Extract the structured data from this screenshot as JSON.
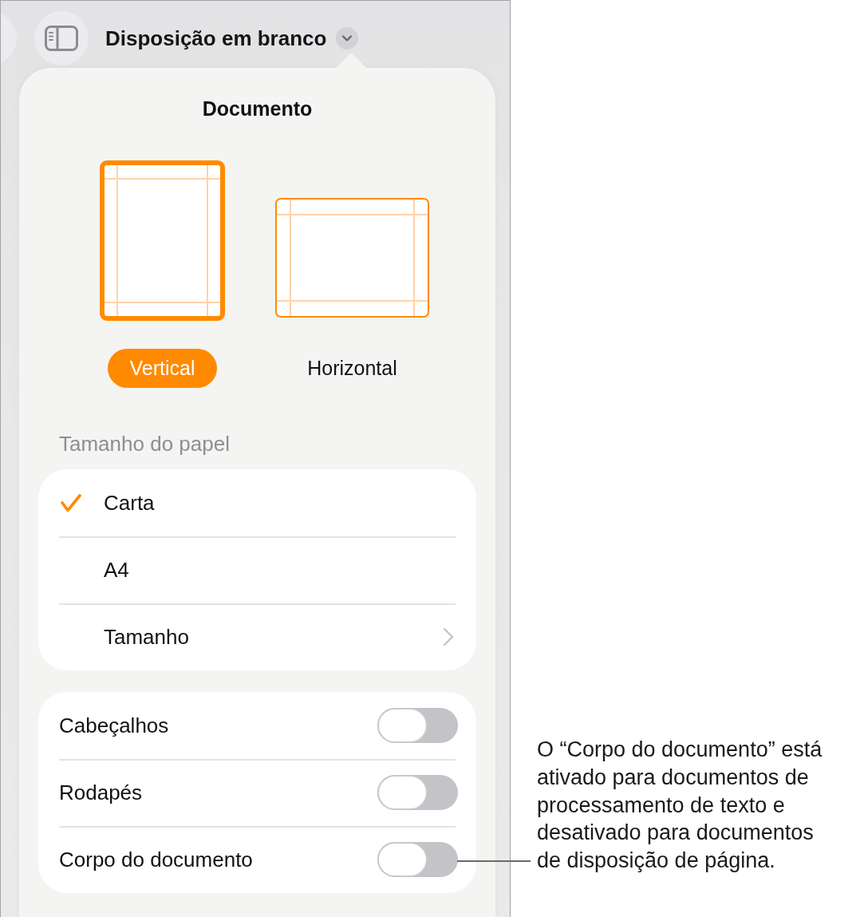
{
  "toolbar": {
    "document_title": "Disposição em branco"
  },
  "popover": {
    "title": "Documento",
    "orientations": [
      {
        "label": "Vertical",
        "kind": "portrait",
        "selected": true
      },
      {
        "label": "Horizontal",
        "kind": "landscape",
        "selected": false
      }
    ],
    "paper_size": {
      "heading": "Tamanho do papel",
      "items": [
        {
          "label": "Carta",
          "kind": "option",
          "selected": true
        },
        {
          "label": "A4",
          "kind": "option",
          "selected": false
        },
        {
          "label": "Tamanho",
          "kind": "submenu",
          "selected": false
        }
      ]
    },
    "toggles": [
      {
        "label": "Cabeçalhos",
        "on": false
      },
      {
        "label": "Rodapés",
        "on": false
      },
      {
        "label": "Corpo do documento",
        "on": false
      }
    ]
  },
  "callout": {
    "text": "O “Corpo do documento” está ativado para documentos de processamento de texto e desativado para documentos de disposição de página."
  }
}
